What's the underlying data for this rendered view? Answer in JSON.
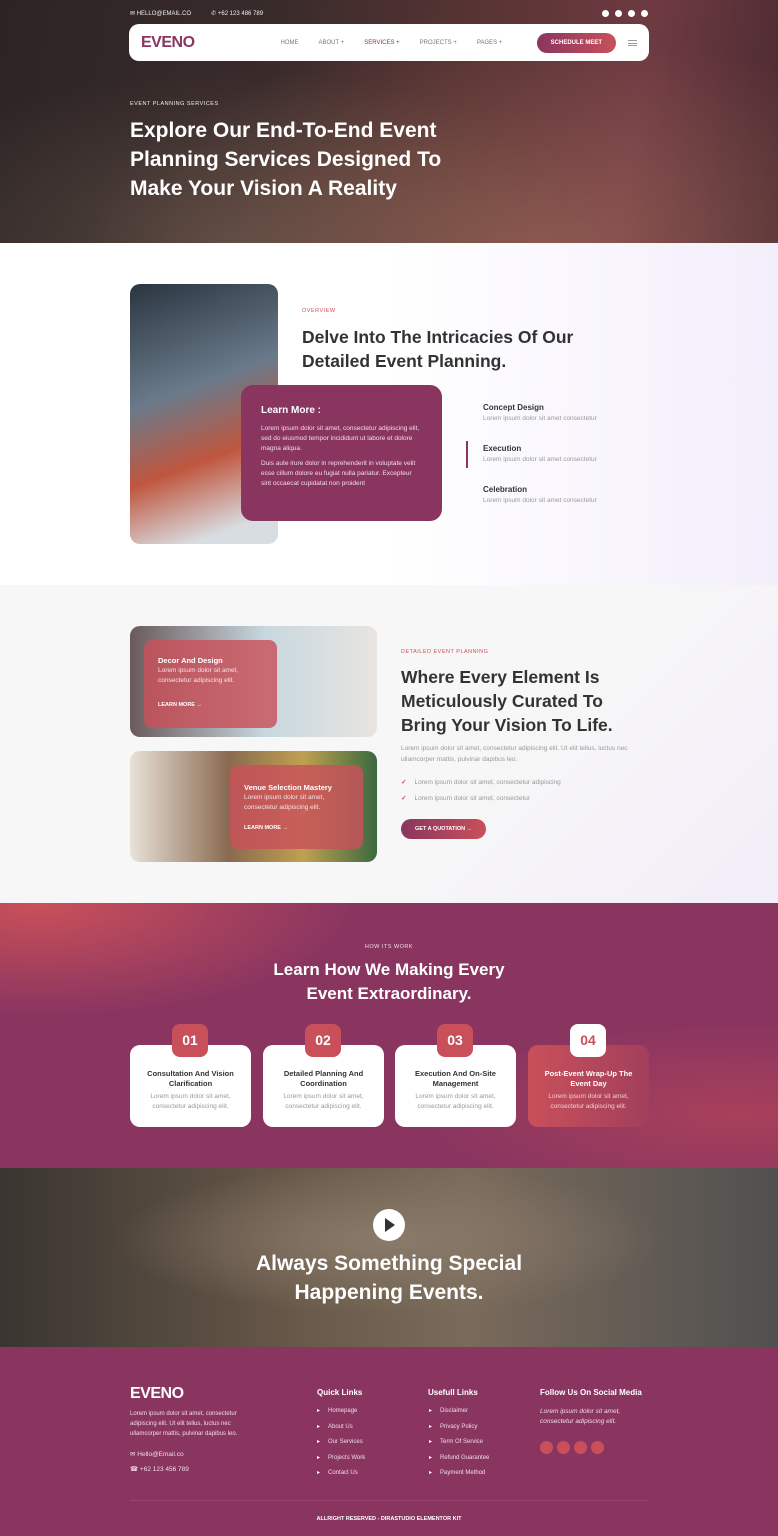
{
  "topbar": {
    "email": "HELLO@EMAIL.CO",
    "phone": "+62 123 486 789",
    "social": [
      "facebook-icon",
      "twitter-icon",
      "youtube-icon",
      "pinterest-icon"
    ]
  },
  "nav": {
    "logo": "EVENO",
    "items": [
      "HOME",
      "ABOUT +",
      "SERVICES +",
      "PROJECTS +",
      "PAGES +"
    ],
    "active": "SERVICES +",
    "cta": "SCHEDULE MEET"
  },
  "hero": {
    "eyebrow": "EVENT PLANNING SERVICES",
    "title": "Explore Our End-To-End Event Planning Services Designed To Make Your Vision A Reality"
  },
  "overview": {
    "eyebrow": "OVERVIEW",
    "title": "Delve Into The Intricacies Of Our Detailed Event Planning.",
    "learn_title": "Learn More :",
    "learn_p1": "Lorem ipsum dolor sit amet, consectetur adipiscing elit, sed do eiusmod tempor incididunt ut labore et dolore magna aliqua.",
    "learn_p2": "Duis aute irure dolor in reprehenderit in voluptate velit esse cillum dolore eu fugiat nulla pariatur. Excepteur sint occaecat cupidatat non proident",
    "features": [
      {
        "title": "Concept Design",
        "text": "Lorem ipsum dolor sit amet consectetur"
      },
      {
        "title": "Execution",
        "text": "Lorem ipsum dolor sit amet consectetur"
      },
      {
        "title": "Celebration",
        "text": "Lorem ipsum dolor sit amet consectetur"
      }
    ],
    "active_feature": "Execution"
  },
  "detailed": {
    "cards": [
      {
        "title": "Decor And Design",
        "text": "Lorem ipsum dolor sit amet, consectetur adipiscing elit.",
        "link": "LEARN MORE →"
      },
      {
        "title": "Venue Selection Mastery",
        "text": "Lorem ipsum dolor sit amet, consectetur adipiscing elit.",
        "link": "LEARN MORE →"
      }
    ],
    "eyebrow": "DETAILED EVENT PLANNING",
    "title": "Where Every Element Is Meticulously Curated To Bring Your Vision To Life.",
    "text": "Lorem ipsum dolor sit amet, consectetur adipiscing elit. Ut elit tellus, luctus nec ullamcorper mattis, pulvinar dapibus leo.",
    "checks": [
      "Lorem ipsum dolor sit amet, consectetur adipiscing",
      "Lorem ipsum dolor sit amet, consectetur"
    ],
    "cta": "GET A QUOTATION →"
  },
  "how": {
    "eyebrow": "HOW ITS WORK",
    "title": "Learn How We Making Every Event Extraordinary.",
    "steps": [
      {
        "num": "01",
        "title": "Consultation And Vision Clarification",
        "text": "Lorem ipsum dolor sit amet, consectetur adipiscing elit."
      },
      {
        "num": "02",
        "title": "Detailed Planning And Coordination",
        "text": "Lorem ipsum dolor sit amet, consectetur adipiscing elit."
      },
      {
        "num": "03",
        "title": "Execution And On-Site Management",
        "text": "Lorem ipsum dolor sit amet, consectetur adipiscing elit."
      },
      {
        "num": "04",
        "title": "Post-Event Wrap-Up The Event Day",
        "text": "Lorem ipsum dolor sit amet, consectetur adipiscing elit."
      }
    ]
  },
  "video": {
    "title": "Always Something Special Happening Events."
  },
  "footer": {
    "logo": "EVENO",
    "about": "Lorem ipsum dolor sit amet, consectetur adipiscing elit. Ut elit tellus, luctus nec ullamcorper mattis, pulvinar dapibus leo.",
    "email": "Hello@Email.co",
    "phone": "+62 123 456 789",
    "quick_title": "Quick Links",
    "quick": [
      "Homepage",
      "About Us",
      "Our Services",
      "Projects Work",
      "Contact Us"
    ],
    "useful_title": "Usefull Links",
    "useful": [
      "Disclaimer",
      "Privacy Policy",
      "Term Of Service",
      "Refund Guarantee",
      "Payment Method"
    ],
    "social_title": "Follow Us On Social Media",
    "social_text": "Lorem ipsum dolor sit amet, consectetur adipiscing elit.",
    "copyright": "ALLRIGHT RESERVED - DIRASTUDIO ELEMENTOR KIT"
  },
  "colors": {
    "primary": "#8a3560",
    "accent": "#c9505a"
  }
}
